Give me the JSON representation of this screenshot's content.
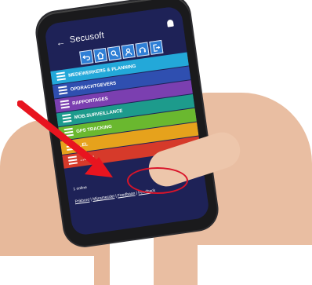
{
  "app": {
    "title": "Secusoft",
    "back_glyph": "←"
  },
  "toolbar": {
    "icons": [
      "undo-icon",
      "home-icon",
      "search-icon",
      "user-icon",
      "headset-icon",
      "exit-icon"
    ]
  },
  "menu": {
    "items": [
      {
        "label": "MEDEWERKERS & PLANNING",
        "color": "#23a8d9"
      },
      {
        "label": "OPDRACHTGEVERS",
        "color": "#2f4fb0"
      },
      {
        "label": "RAPPORTAGES",
        "color": "#7b3fb0"
      },
      {
        "label": "MOB.SURVEILLANCE",
        "color": "#1d9b8c"
      },
      {
        "label": "GPS TRACKING",
        "color": "#6ab82f"
      },
      {
        "label": "...EL",
        "color": "#e6a21c"
      },
      {
        "label": "...GEN",
        "color": "#d63a2a"
      }
    ]
  },
  "footer": {
    "online": "1 online",
    "links": [
      "Prikbord",
      "Mijzamecdet",
      "Feedbaan",
      "Feedback"
    ]
  },
  "colors": {
    "screen_bg": "#1e2257",
    "highlight": "#d9142a"
  }
}
